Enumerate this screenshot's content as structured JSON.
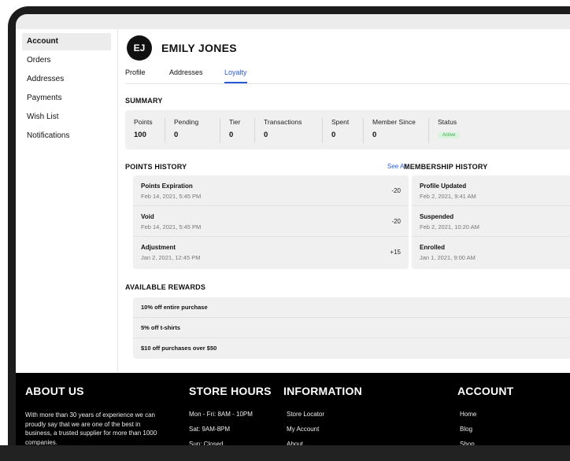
{
  "sidebar": {
    "items": [
      {
        "label": "Account",
        "active": true
      },
      {
        "label": "Orders"
      },
      {
        "label": "Addresses"
      },
      {
        "label": "Payments"
      },
      {
        "label": "Wish List"
      },
      {
        "label": "Notifications"
      }
    ]
  },
  "profile": {
    "initials": "EJ",
    "name": "EMILY JONES",
    "tabs": [
      "Profile",
      "Addresses",
      "Loyalty"
    ],
    "active_tab": "Loyalty"
  },
  "summary": {
    "title": "SUMMARY",
    "columns": [
      {
        "label": "Points",
        "value": "100"
      },
      {
        "label": "Pending",
        "value": "0"
      },
      {
        "label": "Tier",
        "value": "0"
      },
      {
        "label": "Transactions",
        "value": "0"
      },
      {
        "label": "Spent",
        "value": "0"
      },
      {
        "label": "Member Since",
        "value": "0"
      },
      {
        "label": "Status",
        "value": "Active"
      }
    ]
  },
  "points_history": {
    "title": "POINTS HISTORY",
    "see_all": "See All",
    "rows": [
      {
        "title": "Points Expiration",
        "date": "Feb 14, 2021, 5:45 PM",
        "amount": "-20"
      },
      {
        "title": "Void",
        "date": "Feb 14, 2021, 5:45 PM",
        "amount": "-20"
      },
      {
        "title": "Adjustment",
        "date": "Jan 2, 2021, 12:45 PM",
        "amount": "+15"
      }
    ]
  },
  "membership_history": {
    "title": "MEMBERSHIP HISTORY",
    "rows": [
      {
        "title": "Profile Updated",
        "date": "Feb 2, 2021, 9:41 AM"
      },
      {
        "title": "Suspended",
        "date": "Feb 2, 2021, 10:20 AM"
      },
      {
        "title": "Enrolled",
        "date": "Jan 1, 2021, 9:00 AM"
      }
    ]
  },
  "rewards": {
    "title": "AVAILABLE REWARDS",
    "items": [
      "10% off entire purchase",
      "5% off t-shirts",
      "$10 off purchases over $50"
    ]
  },
  "footer": {
    "about": {
      "title": "ABOUT US",
      "text": "With more than 30 years of experience we can proudly say that we are one of the best in business, a trusted supplier for more than 1000 companies."
    },
    "hours": {
      "title": "STORE HOURS",
      "lines": [
        "Mon - Fri: 8AM - 10PM",
        "Sat: 9AM-8PM",
        "Sun: Closed"
      ]
    },
    "information": {
      "title": "INFORMATION",
      "links": [
        "Store Locator",
        "My Account",
        "About"
      ]
    },
    "account": {
      "title": "ACCOUNT",
      "links": [
        "Home",
        "Blog",
        "Shop"
      ]
    }
  },
  "colors": {
    "accent": "#2a5bd7",
    "status_active_bg": "#d9f3dc",
    "status_active_text": "#3cae52",
    "footer_bg": "#000000"
  }
}
